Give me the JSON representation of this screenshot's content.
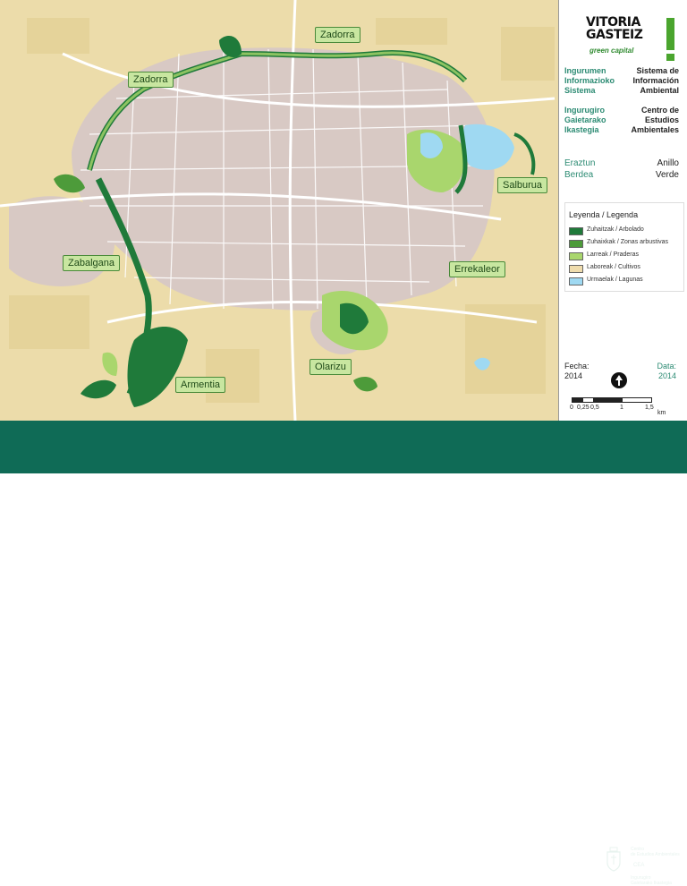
{
  "map": {
    "labels": {
      "zadorra_north": "Zadorra",
      "zadorra_west": "Zadorra",
      "salburua": "Salburua",
      "zabalgana": "Zabalgana",
      "errekaleor": "Errekaleor",
      "olarizu": "Olarizu",
      "armentia": "Armentia"
    },
    "colors": {
      "background_crop": "#ecdcaa",
      "urban": "#d8c9c4",
      "forest": "#1f7a3a",
      "shrub": "#4d9b3a",
      "meadow": "#a9d66d",
      "lagoon": "#9fd9f2",
      "road": "#ffffff"
    }
  },
  "panel": {
    "logo": {
      "line1": "VITORIA",
      "line2": "GASTEIZ",
      "tagline": "green capital"
    },
    "info_system": {
      "left": "Ingurumen Informazioko Sistema",
      "right": "Sistema de Información Ambiental"
    },
    "center": {
      "left": "Ingurugiro Gaietarako Ikastegia",
      "right": "Centro de Estudios Ambientales"
    },
    "ring": {
      "left_1": "Eraztun",
      "left_2": "Berdea",
      "right_1": "Anillo",
      "right_2": "Verde"
    },
    "legend": {
      "title": "Leyenda / Legenda",
      "items": [
        {
          "label": "Zuhaitzak / Arbolado",
          "color": "#1f7a3a"
        },
        {
          "label": "Zuhaixkak / Zonas arbustivas",
          "color": "#4d9b3a"
        },
        {
          "label": "Larreak / Praderas",
          "color": "#a9d66d"
        },
        {
          "label": "Laboreak / Cultivos",
          "color": "#efdcad"
        },
        {
          "label": "Urmaelak / Lagunas",
          "color": "#9fd9f2"
        }
      ]
    },
    "fecha": {
      "label": "Fecha:",
      "value": "2014"
    },
    "data": {
      "label": "Data:",
      "value": "2014"
    },
    "scale": {
      "ticks": [
        "0",
        "0,25",
        "0,5",
        "1",
        "1,5"
      ],
      "unit": "km"
    }
  },
  "footer": {
    "line1": "Centro",
    "line2": "de Estudios Ambientales",
    "cea": "CEA",
    "line3": "Ingurugiro",
    "line4": "Gaietarako Ikastegia"
  }
}
